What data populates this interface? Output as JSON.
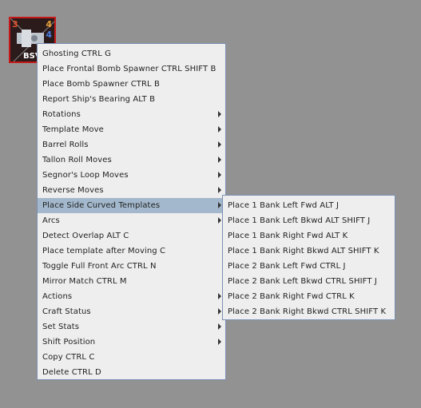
{
  "counter": {
    "stat_left": "3",
    "stat_right_top": "4",
    "stat_right_bottom": "4",
    "label": "BSV",
    "border_color": "#c61818"
  },
  "main_menu": {
    "items": [
      {
        "label": "Ghosting  CTRL G",
        "submenu": false
      },
      {
        "label": "Place Frontal Bomb Spawner  CTRL SHIFT B",
        "submenu": false
      },
      {
        "label": "Place Bomb Spawner  CTRL B",
        "submenu": false
      },
      {
        "label": "Report Ship's Bearing  ALT B",
        "submenu": false
      },
      {
        "label": "Rotations",
        "submenu": true
      },
      {
        "label": "Template Move",
        "submenu": true
      },
      {
        "label": "Barrel Rolls",
        "submenu": true
      },
      {
        "label": "Tallon Roll Moves",
        "submenu": true
      },
      {
        "label": "Segnor's Loop Moves",
        "submenu": true
      },
      {
        "label": "Reverse Moves",
        "submenu": true
      },
      {
        "label": "Place Side Curved Templates",
        "submenu": true,
        "selected": true
      },
      {
        "label": "Arcs",
        "submenu": true
      },
      {
        "label": "Detect Overlap  ALT C",
        "submenu": false
      },
      {
        "label": "Place template after Moving  C",
        "submenu": false
      },
      {
        "label": "Toggle Full Front Arc  CTRL N",
        "submenu": false
      },
      {
        "label": "Mirror Match  CTRL M",
        "submenu": false
      },
      {
        "label": "Actions",
        "submenu": true
      },
      {
        "label": "Craft Status",
        "submenu": true
      },
      {
        "label": "Set Stats",
        "submenu": true
      },
      {
        "label": "Shift Position",
        "submenu": true
      },
      {
        "label": "Copy  CTRL C",
        "submenu": false
      },
      {
        "label": "Delete  CTRL D",
        "submenu": false
      }
    ]
  },
  "sub_menu": {
    "items": [
      {
        "label": "Place 1 Bank Left Fwd  ALT J"
      },
      {
        "label": "Place 1 Bank Left Bkwd  ALT SHIFT J"
      },
      {
        "label": "Place 1 Bank Right Fwd  ALT K"
      },
      {
        "label": "Place 1 Bank Right Bkwd  ALT SHIFT K"
      },
      {
        "label": "Place 2 Bank Left Fwd  CTRL J"
      },
      {
        "label": "Place 2 Bank Left Bkwd  CTRL SHIFT J"
      },
      {
        "label": "Place 2 Bank Right Fwd  CTRL K"
      },
      {
        "label": "Place 2 Bank Right Bkwd  CTRL SHIFT K"
      }
    ]
  },
  "colors": {
    "background": "#929292",
    "menu_bg": "#eeeeee",
    "selected_bg": "#a3b8cc"
  }
}
